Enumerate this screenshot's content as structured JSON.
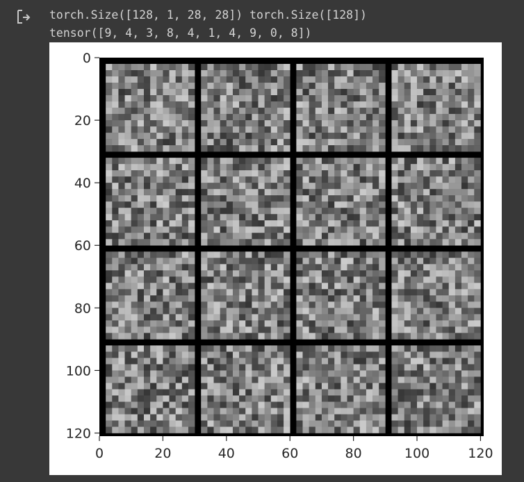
{
  "output": {
    "icon": "output-arrow-icon",
    "lines": [
      "torch.Size([128, 1, 28, 28]) torch.Size([128])",
      "tensor([9, 4, 3, 8, 4, 1, 4, 9, 0, 8])"
    ]
  },
  "image_plot": {
    "description_type": "image",
    "grid_rows": 4,
    "grid_cols": 4,
    "xlim": [
      0,
      121
    ],
    "ylim": [
      121,
      0
    ],
    "xticks": [
      0,
      20,
      40,
      60,
      80,
      100,
      120
    ],
    "yticks": [
      0,
      20,
      40,
      60,
      80,
      100,
      120
    ],
    "xtick_labels": [
      "0",
      "20",
      "40",
      "60",
      "80",
      "100",
      "120"
    ],
    "ytick_labels": [
      "0",
      "20",
      "40",
      "60",
      "80",
      "100",
      "120"
    ],
    "colors": {
      "border": "#000000",
      "noise_mid": "#808080",
      "frame_background": "#ffffff",
      "cell_background": "#383838",
      "text": "#d4d4d4"
    }
  }
}
